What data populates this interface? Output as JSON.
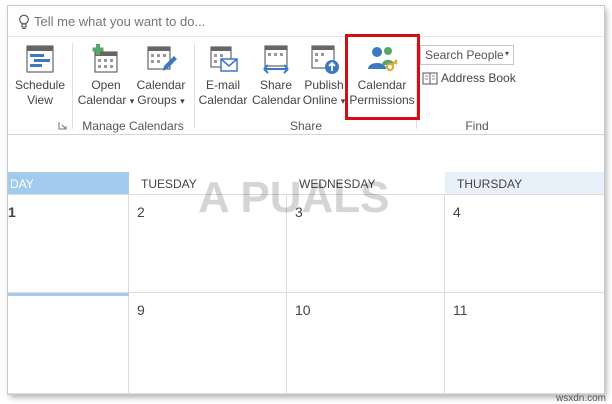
{
  "tell_me": {
    "placeholder": "Tell me what you want to do..."
  },
  "ribbon": {
    "schedule_view": {
      "line1": "Schedule",
      "line2": "View"
    },
    "open_calendar": {
      "line1": "Open",
      "line2": "Calendar"
    },
    "calendar_groups": {
      "line1": "Calendar",
      "line2": "Groups"
    },
    "email_calendar": {
      "line1": "E-mail",
      "line2": "Calendar"
    },
    "share_calendar": {
      "line1": "Share",
      "line2": "Calendar"
    },
    "publish_online": {
      "line1": "Publish",
      "line2": "Online"
    },
    "calendar_permissions": {
      "line1": "Calendar",
      "line2": "Permissions"
    },
    "search_people": "Search People",
    "address_book": "Address Book",
    "groups": {
      "manage_calendars": "Manage Calendars",
      "share": "Share",
      "find": "Find"
    },
    "dropdown_glyph": "▾"
  },
  "calendar": {
    "days": [
      "DAY",
      "TUESDAY",
      "WEDNESDAY",
      "THURSDAY"
    ],
    "week1": [
      "1",
      "2",
      "3",
      "4"
    ],
    "week2": [
      "",
      "9",
      "10",
      "11"
    ]
  },
  "watermark": "A PUALS",
  "credit": "wsxdn.com",
  "colors": {
    "accent_blue": "#a3cbed",
    "highlight_red": "#d40f14",
    "icon_blue": "#3c78c4",
    "icon_green": "#5aa66a"
  }
}
